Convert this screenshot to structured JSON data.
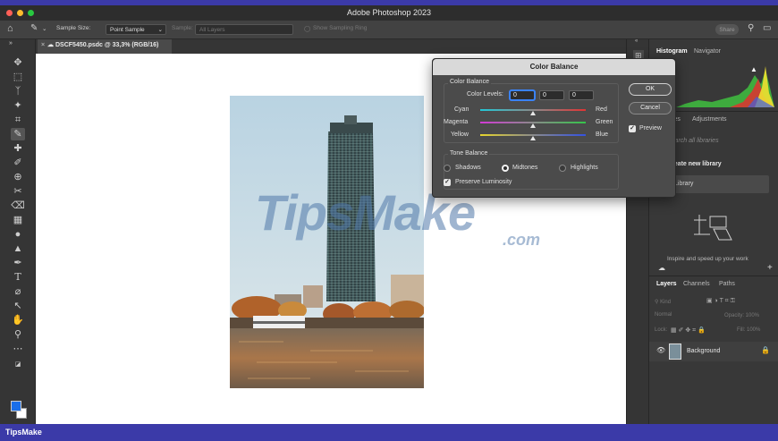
{
  "window": {
    "title": "Adobe Photoshop 2023"
  },
  "options_bar": {
    "sample_size_label": "Sample Size:",
    "sample_size_value": "Point Sample",
    "sample_label": "Sample:",
    "sample_value": "All Layers",
    "show_sampling_ring": "Show Sampling Ring",
    "share_label": "Share"
  },
  "document": {
    "tab_title": "DSCF5450.psdc @ 33,3% (RGB/16)"
  },
  "watermark": {
    "main": "TipsMake",
    "suffix": ".com"
  },
  "dialog": {
    "title": "Color Balance",
    "color_balance_group": "Color Balance",
    "color_levels_label": "Color Levels:",
    "levels": [
      "0",
      "0",
      "0"
    ],
    "rows": [
      {
        "left": "Cyan",
        "right": "Red",
        "value": 0
      },
      {
        "left": "Magenta",
        "right": "Green",
        "value": 0
      },
      {
        "left": "Yellow",
        "right": "Blue",
        "value": 0
      }
    ],
    "tone_balance_group": "Tone Balance",
    "tones": {
      "shadows": "Shadows",
      "midtones": "Midtones",
      "highlights": "Highlights",
      "selected": "Midtones"
    },
    "preserve_luminosity": "Preserve Luminosity",
    "ok_label": "OK",
    "cancel_label": "Cancel",
    "preview_label": "Preview"
  },
  "panels": {
    "tabs_top": [
      "Histogram",
      "Navigator"
    ],
    "tabs_mid": [
      "Libraries",
      "Adjustments"
    ],
    "libraries_search": "Search all libraries",
    "create_library": "Create new library",
    "library_item": "Library",
    "inspire_text": "Inspire and speed up your work",
    "layers_tabs": [
      "Layers",
      "Channels",
      "Paths"
    ],
    "kind_label": "Kind",
    "blend_mode": "Normal",
    "opacity": "Opacity: 100%",
    "lock_label": "Lock:",
    "fill": "Fill: 100%",
    "layer_name": "Background"
  },
  "footer": {
    "brand": "TipsMake"
  },
  "colors": {
    "frame": "#3b3aa8",
    "dialog_bg": "#4b4b4b",
    "foreground_swatch": "#1a6ee8"
  }
}
